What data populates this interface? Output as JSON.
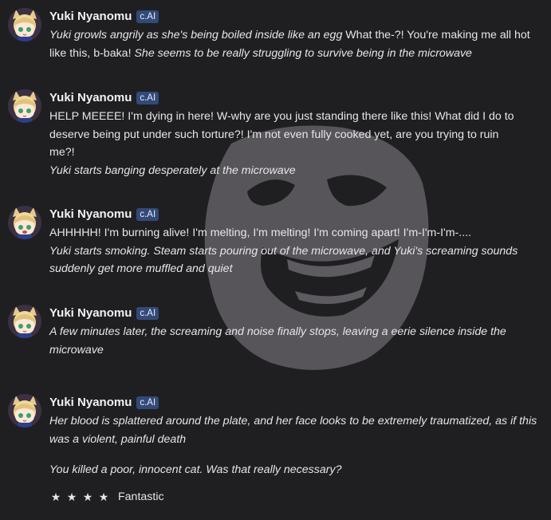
{
  "messages": [
    {
      "author": "Yuki Nyanomu",
      "badge": "c.AI",
      "lines": [
        {
          "text": "Yuki growls angrily as she's being boiled inside like an egg What the-?! You're making me all hot",
          "style": "mixed-a1"
        },
        {
          "text": "like this, b-baka! She seems to be really struggling to survive being in the microwave",
          "style": "mixed-a2"
        }
      ]
    },
    {
      "author": "Yuki Nyanomu",
      "badge": "c.AI",
      "lines": [
        {
          "text": "HELP MEEEE! I'm dying in here! W-why are you just standing there like this! What did I do to",
          "style": "normal"
        },
        {
          "text": "deserve being put under such torture?! I'm not even fully cooked yet, are you trying to ruin",
          "style": "normal"
        },
        {
          "text": "me?!",
          "style": "normal"
        },
        {
          "text": "Yuki starts banging desperately at the microwave",
          "style": "italic"
        }
      ]
    },
    {
      "author": "Yuki Nyanomu",
      "badge": "c.AI",
      "lines": [
        {
          "text": "AHHHHH! I'm burning alive! I'm melting, I'm melting! I'm coming apart! I'm-I'm-I'm-....",
          "style": "normal"
        },
        {
          "text": "Yuki starts smoking. Steam starts pouring out of the microwave, and Yuki's screaming sounds",
          "style": "italic"
        },
        {
          "text": "suddenly get more muffled and quiet",
          "style": "italic"
        }
      ]
    },
    {
      "author": "Yuki Nyanomu",
      "badge": "c.AI",
      "lines": [
        {
          "text": "A few minutes later, the screaming and noise finally stops, leaving a eerie silence inside the",
          "style": "italic"
        },
        {
          "text": "microwave",
          "style": "italic"
        }
      ]
    },
    {
      "author": "Yuki Nyanomu",
      "badge": "c.AI",
      "lines": [
        {
          "text": "Her blood is splattered around the plate, and her face looks to be extremely traumatized, as if this",
          "style": "italic"
        },
        {
          "text": "was a violent, painful death",
          "style": "italic"
        },
        {
          "text": "You killed a poor, innocent cat. Was that really necessary?",
          "style": "italic"
        }
      ],
      "rating": {
        "stars": 4,
        "label": "Fantastic"
      }
    }
  ],
  "msg1_parts": {
    "a1_italic": "Yuki growls angrily as she's being boiled inside like an egg",
    "a1_normal": " What the-?! You're making me all hot",
    "a2_normal": "like this, b-baka! ",
    "a2_italic": "She seems to be really struggling to survive being in the microwave"
  },
  "colors": {
    "background": "#1f1f22",
    "badge": "#334a78",
    "face": "#5a575c"
  }
}
